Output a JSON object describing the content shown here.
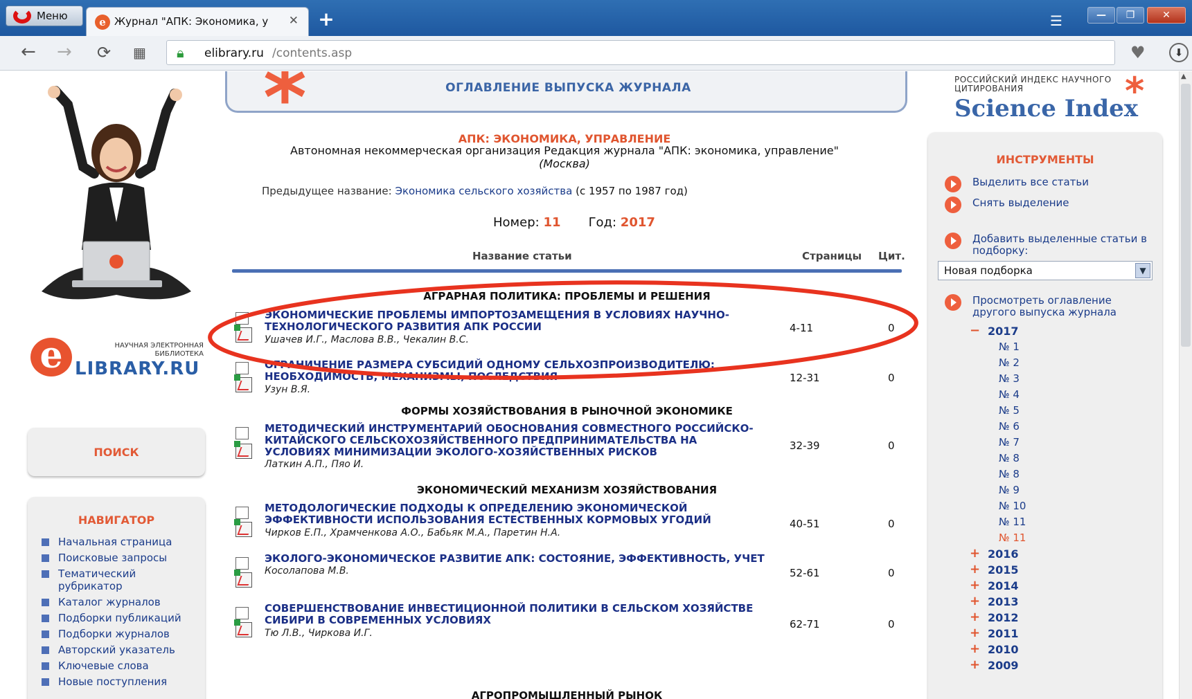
{
  "browser": {
    "menu_label": "Меню",
    "tab_title": "Журнал \"АПК: Экономика, у",
    "tab_close": "✕",
    "new_tab": "+",
    "url_host": "elibrary.ru",
    "url_path": "/contents.asp",
    "window_min": "—",
    "window_max": "❐",
    "window_close": "✕"
  },
  "banner": {
    "title": "ОГЛАВЛЕНИЕ ВЫПУСКА ЖУРНАЛА"
  },
  "left": {
    "logo_top": "НАУЧНАЯ ЭЛЕКТРОННАЯ БИБЛИОТЕКА",
    "logo_name": "LIBRARY.RU",
    "search_label": "ПОИСК",
    "navigator_title": "НАВИГАТОР",
    "navigator_items": [
      "Начальная страница",
      "Поисковые запросы",
      "Тематический рубрикатор",
      "Каталог журналов",
      "Подборки публикаций",
      "Подборки журналов",
      "Авторский указатель",
      "Ключевые слова",
      "Новые поступления"
    ]
  },
  "journal": {
    "name": "АПК: ЭКОНОМИКА, УПРАВЛЕНИЕ",
    "publisher": "Автономная некоммерческая организация Редакция журнала \"АПК: экономика, управление\"",
    "city": "(Москва)",
    "prev_label": "Предыдущее название:",
    "prev_name": "Экономика сельского хозяйства",
    "prev_years": "(с 1957 по 1987 год)",
    "issue_label": "Номер:",
    "issue": "11",
    "year_label": "Год:",
    "year": "2017"
  },
  "columns": {
    "title": "Название статьи",
    "pages": "Страницы",
    "cit": "Цит."
  },
  "sections": [
    "АГРАРНАЯ ПОЛИТИКА: ПРОБЛЕМЫ И РЕШЕНИЯ",
    "ФОРМЫ ХОЗЯЙСТВОВАНИЯ В РЫНОЧНОЙ ЭКОНОМИКЕ",
    "ЭКОНОМИЧЕСКИЙ МЕХАНИЗМ ХОЗЯЙСТВОВАНИЯ",
    "АГРОПРОМЫШЛЕННЫЙ РЫНОК"
  ],
  "articles": [
    {
      "title": "ЭКОНОМИЧЕСКИЕ ПРОБЛЕМЫ ИМПОРТОЗАМЕЩЕНИЯ В УСЛОВИЯХ НАУЧНО-ТЕХНОЛОГИЧЕСКОГО РАЗВИТИЯ АПК РОССИИ",
      "authors": "Ушачев И.Г., Маслова В.В., Чекалин В.С.",
      "pages": "4-11",
      "cit": "0"
    },
    {
      "title": "ОГРАНИЧЕНИЕ РАЗМЕРА СУБСИДИЙ ОДНОМУ СЕЛЬХОЗПРОИЗВОДИТЕЛЮ: НЕОБХОДИМОСТЬ, МЕХАНИЗМЫ, ПОСЛЕДСТВИЯ",
      "authors": "Узун В.Я.",
      "pages": "12-31",
      "cit": "0"
    },
    {
      "title": "МЕТОДИЧЕСКИЙ ИНСТРУМЕНТАРИЙ ОБОСНОВАНИЯ СОВМЕСТНОГО РОССИЙСКО-КИТАЙСКОГО СЕЛЬСКОХОЗЯЙСТВЕННОГО ПРЕДПРИНИМАТЕЛЬСТВА НА УСЛОВИЯХ МИНИМИЗАЦИИ ЭКОЛОГО-ХОЗЯЙСТВЕННЫХ РИСКОВ",
      "authors": "Латкин А.П., Пяо И.",
      "pages": "32-39",
      "cit": "0"
    },
    {
      "title": "МЕТОДОЛОГИЧЕСКИЕ ПОДХОДЫ К ОПРЕДЕЛЕНИЮ ЭКОНОМИЧЕСКОЙ ЭФФЕКТИВНОСТИ ИСПОЛЬЗОВАНИЯ ЕСТЕСТВЕННЫХ КОРМОВЫХ УГОДИЙ",
      "authors": "Чирков Е.П., Храмченкова А.О., Бабьяк М.А., Паретин Н.А.",
      "pages": "40-51",
      "cit": "0"
    },
    {
      "title": "ЭКОЛОГО-ЭКОНОМИЧЕСКОЕ РАЗВИТИЕ АПК: СОСТОЯНИЕ, ЭФФЕКТИВНОСТЬ, УЧЕТ",
      "authors": "Косолапова М.В.",
      "pages": "52-61",
      "cit": "0"
    },
    {
      "title": "СОВЕРШЕНСТВОВАНИЕ ИНВЕСТИЦИОННОЙ ПОЛИТИКИ В СЕЛЬСКОМ ХОЗЯЙСТВЕ СИБИРИ В СОВРЕМЕННЫХ УСЛОВИЯХ",
      "authors": "Тю Л.В., Чиркова И.Г.",
      "pages": "62-71",
      "cit": "0"
    }
  ],
  "science_index": {
    "top": "РОССИЙСКИЙ ИНДЕКС НАУЧНОГО ЦИТИРОВАНИЯ",
    "name": "Science Index"
  },
  "tools": {
    "title": "ИНСТРУМЕНТЫ",
    "select_all": "Выделить все статьи",
    "unselect": "Снять выделение",
    "add": "Добавить выделенные статьи в подборку:",
    "collection_value": "Новая подборка",
    "view_other": "Просмотреть оглавление другого выпуска журнала",
    "year_open": "2017",
    "issues": [
      "№ 1",
      "№ 2",
      "№ 3",
      "№ 4",
      "№ 5",
      "№ 6",
      "№ 7",
      "№ 8",
      "№ 8",
      "№ 9",
      "№ 10",
      "№ 11",
      "№ 11"
    ],
    "other_years": [
      "2016",
      "2015",
      "2014",
      "2013",
      "2012",
      "2011",
      "2010",
      "2009"
    ]
  },
  "colors": {
    "accent": "#e0552f",
    "link": "#1b2f86",
    "highlight_ellipse": "#e8331f"
  }
}
